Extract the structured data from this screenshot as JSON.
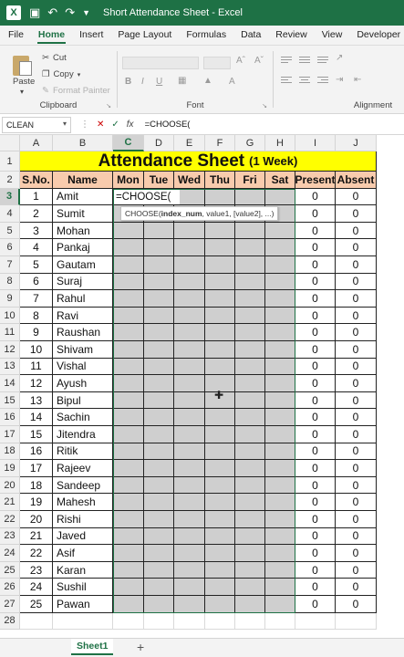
{
  "title_bar": {
    "title": "Short Attendance Sheet  -  Excel"
  },
  "menu_tabs": [
    "File",
    "Home",
    "Insert",
    "Page Layout",
    "Formulas",
    "Data",
    "Review",
    "View",
    "Developer",
    "Help"
  ],
  "active_tab": "Home",
  "ribbon": {
    "paste_label": "Paste",
    "cut_label": "Cut",
    "copy_label": "Copy",
    "format_painter_label": "Format Painter",
    "clipboard_label": "Clipboard",
    "font_label": "Font",
    "alignment_label": "Alignment",
    "bold_label": "B",
    "italic_label": "I",
    "underline_label": "U"
  },
  "formula_bar": {
    "name_box": "CLEAN",
    "fx_label": "fx",
    "formula": "=CHOOSE("
  },
  "columns": [
    "A",
    "B",
    "C",
    "D",
    "E",
    "F",
    "G",
    "H",
    "I",
    "J"
  ],
  "rows": [
    "1",
    "2",
    "3",
    "4",
    "5",
    "6",
    "7",
    "8",
    "9",
    "10",
    "11",
    "12",
    "13",
    "14",
    "15",
    "16",
    "17",
    "18",
    "19",
    "20",
    "21",
    "22",
    "23",
    "24",
    "25",
    "26",
    "27",
    "28"
  ],
  "sheet": {
    "title_main": "Attendance Sheet",
    "title_sub": "(1 Week)",
    "headers": [
      "S.No.",
      "Name",
      "Mon",
      "Tue",
      "Wed",
      "Thu",
      "Fri",
      "Sat",
      "Present",
      "Absent"
    ],
    "records": [
      {
        "sno": "1",
        "name": "Amit",
        "present": "0",
        "absent": "0"
      },
      {
        "sno": "2",
        "name": "Sumit",
        "present": "0",
        "absent": "0"
      },
      {
        "sno": "3",
        "name": "Mohan",
        "present": "0",
        "absent": "0"
      },
      {
        "sno": "4",
        "name": "Pankaj",
        "present": "0",
        "absent": "0"
      },
      {
        "sno": "5",
        "name": "Gautam",
        "present": "0",
        "absent": "0"
      },
      {
        "sno": "6",
        "name": "Suraj",
        "present": "0",
        "absent": "0"
      },
      {
        "sno": "7",
        "name": "Rahul",
        "present": "0",
        "absent": "0"
      },
      {
        "sno": "8",
        "name": "Ravi",
        "present": "0",
        "absent": "0"
      },
      {
        "sno": "9",
        "name": "Raushan",
        "present": "0",
        "absent": "0"
      },
      {
        "sno": "10",
        "name": "Shivam",
        "present": "0",
        "absent": "0"
      },
      {
        "sno": "11",
        "name": "Vishal",
        "present": "0",
        "absent": "0"
      },
      {
        "sno": "12",
        "name": "Ayush",
        "present": "0",
        "absent": "0"
      },
      {
        "sno": "13",
        "name": "Bipul",
        "present": "0",
        "absent": "0"
      },
      {
        "sno": "14",
        "name": "Sachin",
        "present": "0",
        "absent": "0"
      },
      {
        "sno": "15",
        "name": "Jitendra",
        "present": "0",
        "absent": "0"
      },
      {
        "sno": "16",
        "name": "Ritik",
        "present": "0",
        "absent": "0"
      },
      {
        "sno": "17",
        "name": "Rajeev",
        "present": "0",
        "absent": "0"
      },
      {
        "sno": "18",
        "name": "Sandeep",
        "present": "0",
        "absent": "0"
      },
      {
        "sno": "19",
        "name": "Mahesh",
        "present": "0",
        "absent": "0"
      },
      {
        "sno": "20",
        "name": "Rishi",
        "present": "0",
        "absent": "0"
      },
      {
        "sno": "21",
        "name": "Javed",
        "present": "0",
        "absent": "0"
      },
      {
        "sno": "22",
        "name": "Asif",
        "present": "0",
        "absent": "0"
      },
      {
        "sno": "23",
        "name": "Karan",
        "present": "0",
        "absent": "0"
      },
      {
        "sno": "24",
        "name": "Sushil",
        "present": "0",
        "absent": "0"
      },
      {
        "sno": "25",
        "name": "Pawan",
        "present": "0",
        "absent": "0"
      }
    ],
    "active_cell_text": "=CHOOSE(",
    "tooltip": {
      "fn": "CHOOSE(",
      "arg_bold": "index_num",
      "rest": ", value1, [value2], ...)"
    }
  },
  "sheet_tabs": {
    "active": "Sheet1",
    "add_label": "+"
  },
  "colors": {
    "excel_green": "#1e7145",
    "title_fill": "#ffff00",
    "header_fill": "#f8cbad",
    "day_fill": "#cfcfcf"
  }
}
